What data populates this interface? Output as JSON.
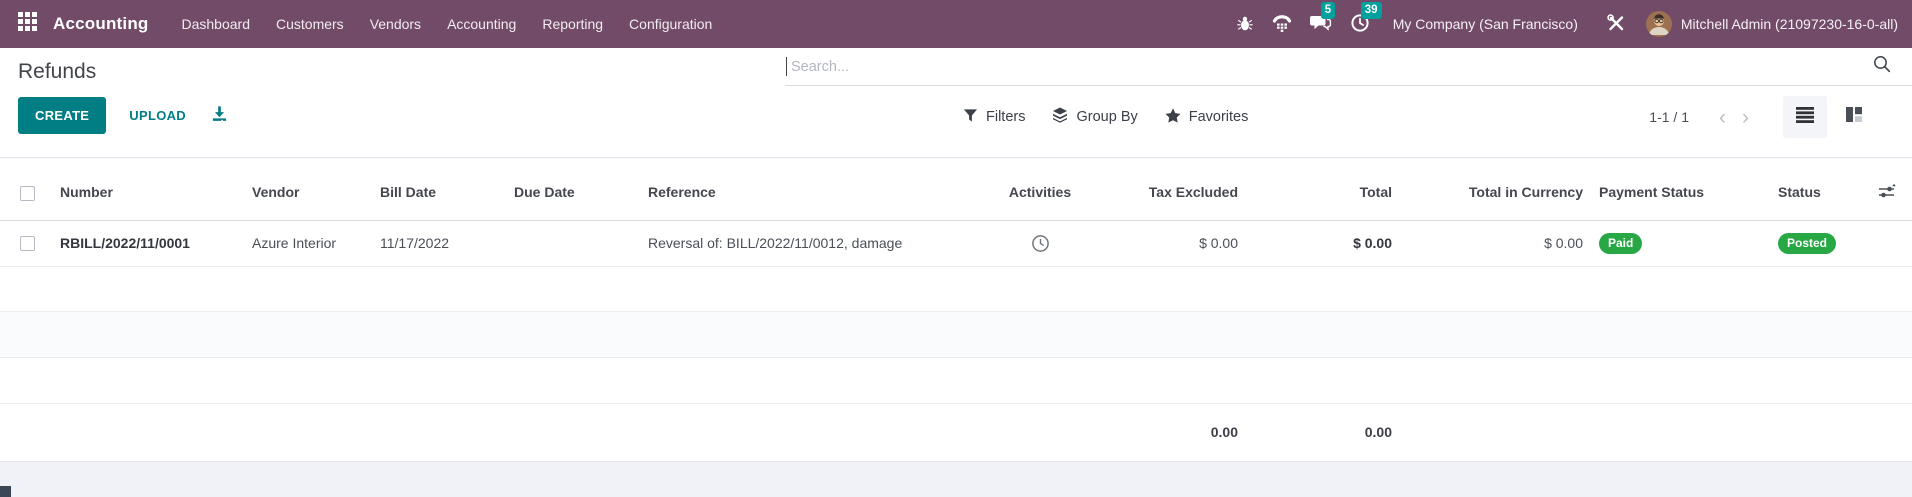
{
  "topbar": {
    "app_name": "Accounting",
    "menus": [
      "Dashboard",
      "Customers",
      "Vendors",
      "Accounting",
      "Reporting",
      "Configuration"
    ],
    "message_badge": "5",
    "activity_badge": "39",
    "company": "My Company (San Francisco)",
    "user": "Mitchell Admin (21097230-16-0-all)"
  },
  "control_panel": {
    "title": "Refunds",
    "create_label": "CREATE",
    "upload_label": "UPLOAD",
    "search_placeholder": "Search...",
    "filters_label": "Filters",
    "group_by_label": "Group By",
    "favorites_label": "Favorites",
    "pager": "1-1 / 1"
  },
  "icons": {
    "chevron_left": "‹",
    "chevron_right": "›"
  },
  "table": {
    "columns": [
      "Number",
      "Vendor",
      "Bill Date",
      "Due Date",
      "Reference",
      "Activities",
      "Tax Excluded",
      "Total",
      "Total in Currency",
      "Payment Status",
      "Status"
    ],
    "rows": [
      {
        "number": "RBILL/2022/11/0001",
        "vendor": "Azure Interior",
        "bill_date": "11/17/2022",
        "due_date": "",
        "reference": "Reversal of: BILL/2022/11/0012, damage",
        "tax_excluded": "$ 0.00",
        "total": "$ 0.00",
        "total_in_currency": "$ 0.00",
        "payment_status": "Paid",
        "status": "Posted"
      }
    ],
    "footer": {
      "tax_excluded": "0.00",
      "total": "0.00"
    }
  },
  "colors": {
    "topbar": "#714b67",
    "accent_teal": "#017e84",
    "badge_teal": "#00a09d",
    "success_green": "#28a745"
  }
}
